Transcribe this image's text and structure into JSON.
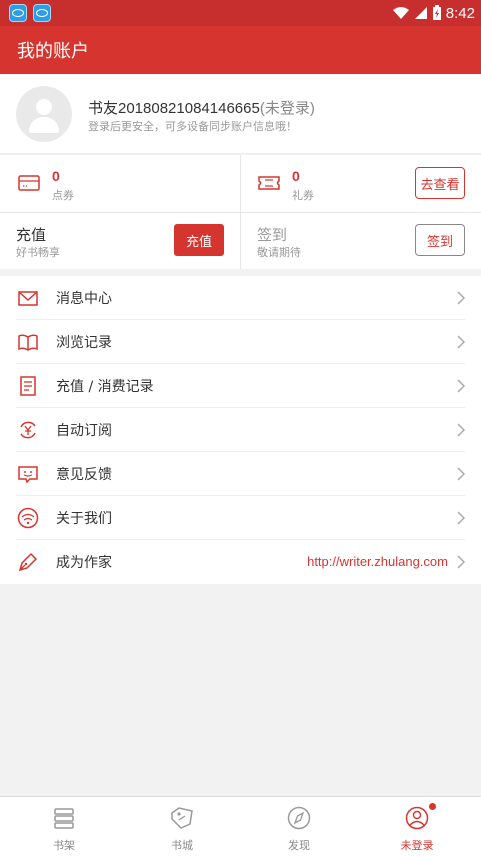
{
  "status_bar": {
    "time": "8:42"
  },
  "app_bar": {
    "title": "我的账户"
  },
  "profile": {
    "username": "书友20180821084146665",
    "login_state": "(未登录)",
    "tip": "登录后更安全，可多设备同步账户信息哦！"
  },
  "wallet": {
    "points_value": "0",
    "points_label": "点券",
    "gift_value": "0",
    "gift_label": "礼券",
    "view_button": "去查看",
    "recharge_title": "充值",
    "recharge_sub": "好书畅享",
    "recharge_button": "充值",
    "signin_title": "签到",
    "signin_sub": "敬请期待",
    "signin_button": "签到"
  },
  "menu": {
    "items": [
      {
        "label": "消息中心",
        "icon": "mail-icon"
      },
      {
        "label": "浏览记录",
        "icon": "open-book-icon"
      },
      {
        "label": "充值 / 消费记录",
        "icon": "receipt-icon"
      },
      {
        "label": "自动订阅",
        "icon": "auto-renew-yen-icon"
      },
      {
        "label": "意见反馈",
        "icon": "feedback-smile-icon"
      },
      {
        "label": "关于我们",
        "icon": "signal-waves-icon"
      },
      {
        "label": "成为作家",
        "icon": "pen-icon",
        "link": "http://writer.zhulang.com"
      }
    ]
  },
  "tabbar": {
    "items": [
      {
        "label": "书架",
        "icon": "bookshelf-icon"
      },
      {
        "label": "书城",
        "icon": "tag-icon"
      },
      {
        "label": "发现",
        "icon": "compass-icon"
      },
      {
        "label": "未登录",
        "icon": "user-icon",
        "active": true
      }
    ]
  },
  "colors": {
    "accent": "#d6352f",
    "status_bar": "#c72f2e"
  }
}
